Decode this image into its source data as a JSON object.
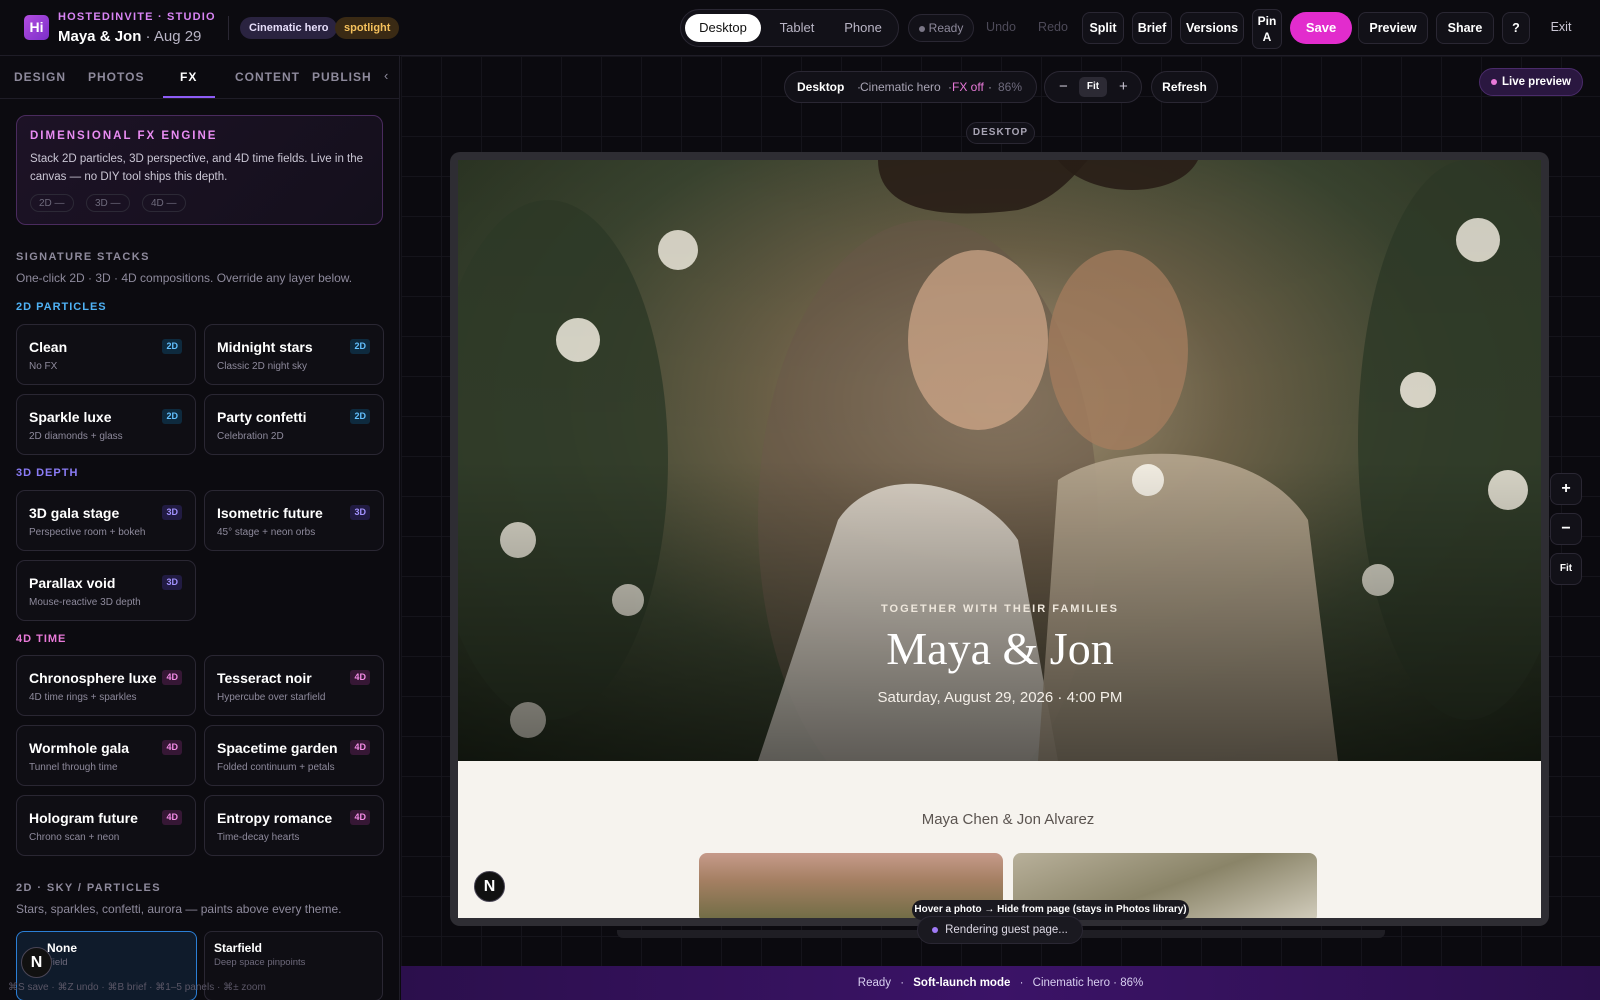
{
  "header": {
    "brand_eyebrow": "HOSTEDINVITE · STUDIO",
    "logo_text": "Hi",
    "event_names": "Maya & Jon",
    "event_date": " · Aug 29",
    "tags": [
      "Cinematic hero",
      "spotlight"
    ],
    "devices": [
      "Desktop",
      "Tablet",
      "Phone"
    ],
    "active_device": "Desktop",
    "status": "Ready",
    "undo": "Undo",
    "redo": "Redo",
    "split": "Split",
    "brief": "Brief",
    "versions": "Versions",
    "pin_line1": "Pin",
    "pin_line2": "A",
    "save": "Save",
    "preview": "Preview",
    "share": "Share",
    "help": "?",
    "exit": "Exit",
    "accent_color": "#e22ccd"
  },
  "sidebar": {
    "tabs": [
      "DESIGN",
      "PHOTOS",
      "FX",
      "CONTENT",
      "PUBLISH"
    ],
    "active_tab": "FX",
    "collapse_icon": "‹",
    "fx_engine": {
      "title": "DIMENSIONAL FX ENGINE",
      "description": "Stack 2D particles, 3D perspective, and 4D time fields. Live in the canvas — no DIY tool ships this depth.",
      "chips": [
        "2D —",
        "3D —",
        "4D —"
      ]
    },
    "signature": {
      "label": "SIGNATURE STACKS",
      "description": "One-click 2D · 3D · 4D compositions. Override any layer below."
    },
    "categories": {
      "particles_2d": "2D PARTICLES",
      "depth_3d": "3D DEPTH",
      "time_4d": "4D TIME"
    },
    "cards_2d": [
      {
        "title": "Clean",
        "sub": "No FX",
        "badge": "2D"
      },
      {
        "title": "Midnight stars",
        "sub": "Classic 2D night sky",
        "badge": "2D"
      },
      {
        "title": "Sparkle luxe",
        "sub": "2D diamonds + glass",
        "badge": "2D"
      },
      {
        "title": "Party confetti",
        "sub": "Celebration 2D",
        "badge": "2D"
      }
    ],
    "cards_3d": [
      {
        "title": "3D gala stage",
        "sub": "Perspective room + bokeh",
        "badge": "3D"
      },
      {
        "title": "Isometric future",
        "sub": "45° stage + neon orbs",
        "badge": "3D"
      },
      {
        "title": "Parallax void",
        "sub": "Mouse-reactive 3D depth",
        "badge": "3D"
      }
    ],
    "cards_4d": [
      {
        "title": "Chronosphere luxe",
        "sub": "4D time rings + sparkles",
        "badge": "4D"
      },
      {
        "title": "Tesseract noir",
        "sub": "Hypercube over starfield",
        "badge": "4D"
      },
      {
        "title": "Wormhole gala",
        "sub": "Tunnel through time",
        "badge": "4D"
      },
      {
        "title": "Spacetime garden",
        "sub": "Folded continuum + petals",
        "badge": "4D"
      },
      {
        "title": "Hologram future",
        "sub": "Chrono scan + neon",
        "badge": "4D"
      },
      {
        "title": "Entropy romance",
        "sub": "Time-decay hearts",
        "badge": "4D"
      }
    ],
    "sky": {
      "label": "2D · SKY / PARTICLES",
      "description": "Stars, sparkles, confetti, aurora — paints above every theme.",
      "cards": [
        {
          "title": "None",
          "sub": "Field"
        },
        {
          "title": "Starfield",
          "sub": "Deep space pinpoints"
        }
      ]
    },
    "n_badge": "N",
    "shortcuts": "⌘S save · ⌘Z undo · ⌘B brief · ⌘1–5 panels · ⌘± zoom"
  },
  "canvas": {
    "info": {
      "device": "Desktop",
      "theme": "Cinematic hero",
      "fx": "FX off",
      "zoom": "86%",
      "sep": "·"
    },
    "zoom_out": "−",
    "fit": "Fit",
    "zoom_in": "+",
    "refresh": "Refresh",
    "live_preview": "Live preview",
    "device_label": "DESKTOP",
    "right_zoom_in": "+",
    "right_zoom_out": "−",
    "right_fit": "Fit",
    "hover_hint": "Hover a photo → Hide from page (stays in Photos library)",
    "rendering": "Rendering guest page..."
  },
  "invite": {
    "eyebrow": "TOGETHER WITH THEIR FAMILIES",
    "names": "Maya & Jon",
    "date_time": "Saturday, August 29, 2026 · 4:00 PM",
    "full_names": "Maya Chen & Jon Alvarez"
  },
  "statusbar": {
    "status": "Ready",
    "sep": "·",
    "mode": "Soft-launch mode",
    "theme_zoom": "Cinematic hero · 86%"
  }
}
